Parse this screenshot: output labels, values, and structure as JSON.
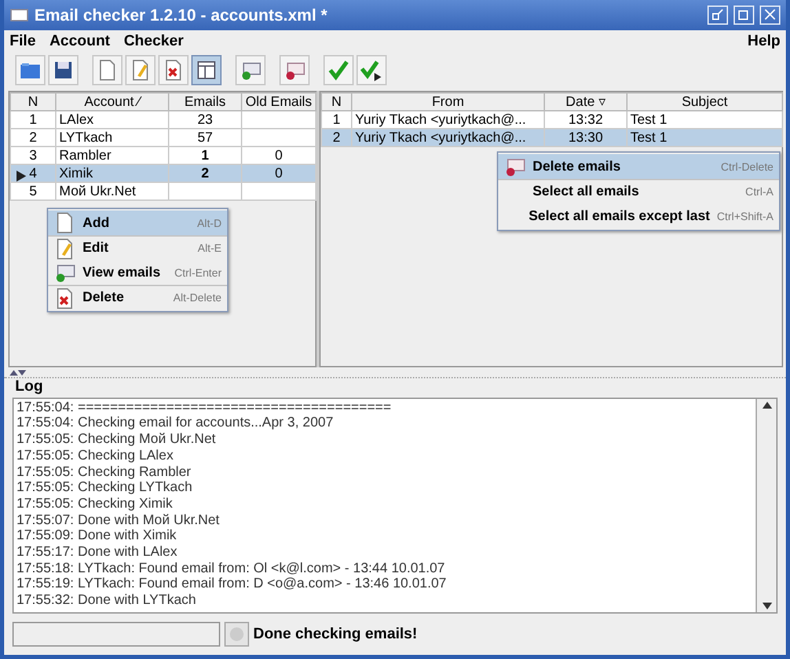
{
  "window": {
    "title": "Email checker 1.2.10 - accounts.xml *"
  },
  "menu": [
    {
      "label": "File"
    },
    {
      "label": "Account"
    },
    {
      "label": "Checker"
    },
    {
      "label": "Help"
    }
  ],
  "toolbar": [
    {
      "kind": "open",
      "selected": false
    },
    {
      "kind": "save",
      "selected": false
    },
    {
      "kind": "new",
      "selected": false
    },
    {
      "kind": "edit",
      "selected": false
    },
    {
      "kind": "delete",
      "selected": false
    },
    {
      "kind": "view",
      "selected": true
    },
    {
      "kind": "mail-add",
      "selected": false
    },
    {
      "kind": "mail-delete",
      "selected": false
    },
    {
      "kind": "check",
      "selected": false
    },
    {
      "kind": "check-next",
      "selected": false
    }
  ],
  "accounts": {
    "columns": [
      "N",
      "Account ⁄",
      "Emails",
      "Old Emails"
    ],
    "rows": [
      {
        "n": "1",
        "account": "LAlex",
        "emails": "23",
        "old": "",
        "new": false,
        "selected": false,
        "current": false
      },
      {
        "n": "2",
        "account": "LYTkach",
        "emails": "57",
        "old": "",
        "new": false,
        "selected": false,
        "current": false
      },
      {
        "n": "3",
        "account": "Rambler",
        "emails": "1",
        "old": "0",
        "new": true,
        "selected": false,
        "current": false
      },
      {
        "n": "4",
        "account": "Ximik",
        "emails": "2",
        "old": "0",
        "new": true,
        "selected": true,
        "current": true
      },
      {
        "n": "5",
        "account": "Мой Ukr.Net",
        "emails": "",
        "old": "",
        "new": false,
        "selected": false,
        "current": false
      }
    ]
  },
  "account_menu": [
    {
      "kind": "new",
      "label": "Add",
      "shortcut": "Alt-D",
      "selected": true,
      "separator": false
    },
    {
      "kind": "edit",
      "label": "Edit",
      "shortcut": "Alt-E",
      "selected": false,
      "separator": true
    },
    {
      "kind": "mail-add",
      "label": "View emails",
      "shortcut": "Ctrl-Enter",
      "selected": false,
      "separator": false
    },
    {
      "kind": "delete",
      "label": "Delete",
      "shortcut": "Alt-Delete",
      "selected": false,
      "separator": true
    }
  ],
  "emails": {
    "columns": [
      "N",
      "From",
      "Date ▿",
      "Subject"
    ],
    "rows": [
      {
        "n": "1",
        "from": "Yuriy Tkach <yuriytkach@...",
        "date": "13:32",
        "subject": "Test 1",
        "selected": false
      },
      {
        "n": "2",
        "from": "Yuriy Tkach <yuriytkach@...",
        "date": "13:30",
        "subject": "Test 1",
        "selected": true
      }
    ]
  },
  "email_menu": [
    {
      "kind": "mail-delete",
      "label": "Delete emails",
      "shortcut": "Ctrl-Delete",
      "selected": true,
      "separator": false
    },
    {
      "kind": "none",
      "label": "Select all emails",
      "shortcut": "Ctrl-A",
      "selected": false,
      "separator": true
    },
    {
      "kind": "none",
      "label": "Select all emails except last",
      "shortcut": "Ctrl+Shift-A",
      "selected": false,
      "separator": false
    }
  ],
  "log": {
    "title": "Log",
    "lines": [
      "17:55:04: =======================================",
      "17:55:04: Checking email for accounts...Apr 3, 2007",
      "17:55:05: Checking Мой Ukr.Net",
      "17:55:05: Checking LAlex",
      "17:55:05: Checking Rambler",
      "17:55:05: Checking LYTkach",
      "17:55:05: Checking Ximik",
      "17:55:07: Done with Мой Ukr.Net",
      "17:55:09: Done with Ximik",
      "17:55:17: Done with LAlex",
      "17:55:18: LYTkach: Found email from: Ol <k@l.com> - 13:44 10.01.07",
      "17:55:19: LYTkach: Found email from: D <o@a.com> - 13:46 10.01.07",
      "17:55:32: Done with LYTkach"
    ]
  },
  "status": {
    "message": "Done checking emails!"
  }
}
